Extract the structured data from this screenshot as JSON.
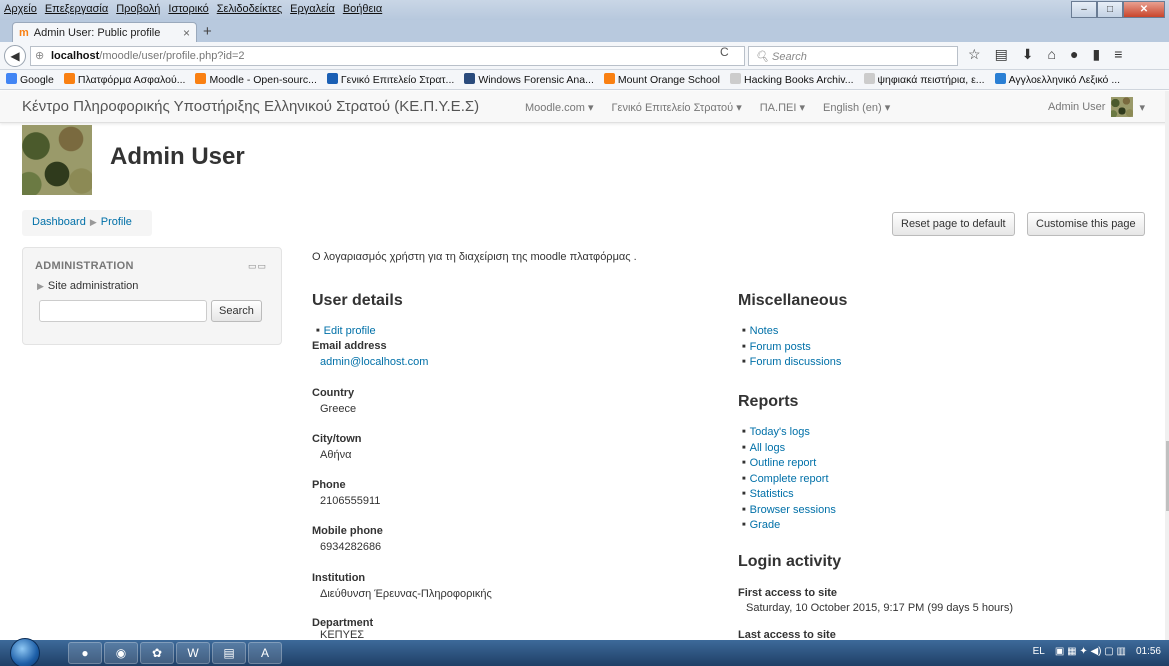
{
  "browser": {
    "menu": [
      "Αρχείο",
      "Επεξεργασία",
      "Προβολή",
      "Ιστορικό",
      "Σελιδοδείκτες",
      "Εργαλεία",
      "Βοήθεια"
    ],
    "tab_title": "Admin User: Public profile",
    "url_host": "localhost",
    "url_path": "/moodle/user/profile.php?id=2",
    "search_placeholder": "Search",
    "bookmarks": [
      {
        "label": "Google",
        "color": "#4285f4"
      },
      {
        "label": "Πλατφόρμα Ασφαλού...",
        "color": "#f98012"
      },
      {
        "label": "Moodle - Open-sourc...",
        "color": "#f98012"
      },
      {
        "label": "Γενικό Επιτελείο Στρατ...",
        "color": "#1a5fb4"
      },
      {
        "label": "Windows Forensic Ana...",
        "color": "#2a4b7c"
      },
      {
        "label": "Mount Orange School",
        "color": "#f98012"
      },
      {
        "label": "Hacking Books Archiv...",
        "color": "#cccccc"
      },
      {
        "label": "ψηφιακά πειστήρια, ε...",
        "color": "#cccccc"
      },
      {
        "label": "Αγγλοελληνικό Λεξικό ...",
        "color": "#2a7fd4"
      }
    ]
  },
  "moodle": {
    "site_name": "Κέντρο Πληροφορικής Υποστήριξης Ελληνικού Στρατού (ΚΕ.Π.Υ.Ε.Σ)",
    "nav_menu": [
      "Moodle.com ▾",
      "Γενικό Επιτελείο Στρατού ▾",
      "ΠΑ.ΠΕΙ ▾",
      "English (en) ▾"
    ],
    "user_name": "Admin User",
    "page_title": "Admin User",
    "breadcrumb": [
      "Dashboard",
      "Profile"
    ],
    "buttons": {
      "reset": "Reset page to default",
      "customise": "Customise this page"
    },
    "admin_block": {
      "title": "ADMINISTRATION",
      "item": "Site administration",
      "search_button": "Search"
    },
    "description": "Ο λογαριασμός χρήστη για τη διαχείριση της moodle πλατφόρμας .",
    "user_details": {
      "heading": "User details",
      "edit_profile": "Edit profile",
      "fields": [
        {
          "label": "Email address",
          "value": "admin@localhost.com"
        },
        {
          "label": "Country",
          "value": "Greece"
        },
        {
          "label": "City/town",
          "value": "Αθήνα"
        },
        {
          "label": "Phone",
          "value": "2106555911"
        },
        {
          "label": "Mobile phone",
          "value": "6934282686"
        },
        {
          "label": "Institution",
          "value": "Διεύθυνση Έρευνας-Πληροφορικής"
        },
        {
          "label": "Department",
          "value": "ΚΕΠΥΕΣ"
        }
      ]
    },
    "misc": {
      "heading": "Miscellaneous",
      "items": [
        "Notes",
        "Forum posts",
        "Forum discussions"
      ]
    },
    "reports": {
      "heading": "Reports",
      "items": [
        "Today's logs",
        "All logs",
        "Outline report",
        "Complete report",
        "Statistics",
        "Browser sessions",
        "Grade"
      ]
    },
    "login": {
      "heading": "Login activity",
      "first_label": "First access to site",
      "first_value": "Saturday, 10 October 2015, 9:17 PM  (99 days 5 hours)",
      "last_label": "Last access to site"
    }
  },
  "taskbar": {
    "lang": "EL",
    "time": "01:56"
  }
}
